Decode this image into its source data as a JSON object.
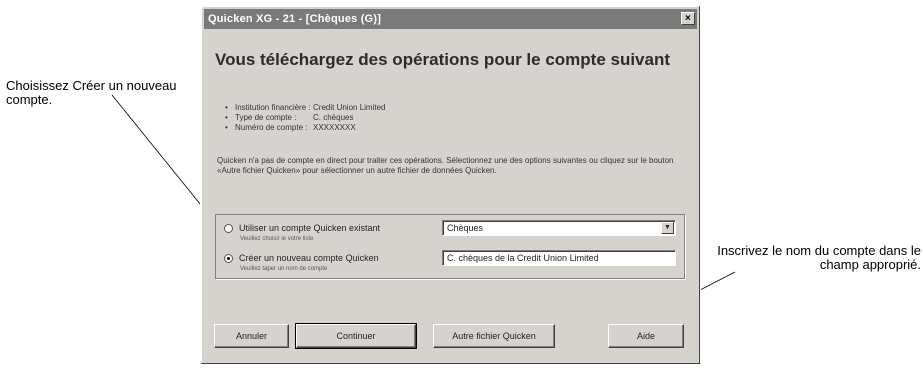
{
  "annotations": {
    "left": "Choisissez Créer un nouveau compte.",
    "right": "Inscrivez le nom du compte dans le champ approprié."
  },
  "window": {
    "title": "Quicken XG - 21 - [Chèques (G)]",
    "close_glyph": "×",
    "heading": "Vous téléchargez des opérations pour le compte suivant",
    "info": [
      {
        "label": "Institution financière :",
        "value": "Credit Union Limited"
      },
      {
        "label": "Type de compte :",
        "value": "C. chèques"
      },
      {
        "label": "Numéro de compte :",
        "value": "XXXXXXXX"
      }
    ],
    "paragraph": "Quicken n'a pas de compte en direct pour traiter ces opérations. Sélectionnez une des options suivantes ou cliquez sur le bouton «Autre fichier Quicken» pour sélectionner un autre fichier de données Quicken.",
    "option_existing": {
      "label": "Utiliser un compte Quicken existant",
      "hint": "Veuillez choisir le votre liste",
      "selected": false,
      "value": "Chèques"
    },
    "option_new": {
      "label": "Créer un nouveau compte Quicken",
      "hint": "Veuillez taper un nom de compte",
      "selected": true,
      "value": "C. chèques de la Credit Union Limited"
    },
    "buttons": {
      "cancel": "Annuler",
      "continue": "Continuer",
      "other": "Autre fichier Quicken",
      "help": "Aide"
    }
  }
}
